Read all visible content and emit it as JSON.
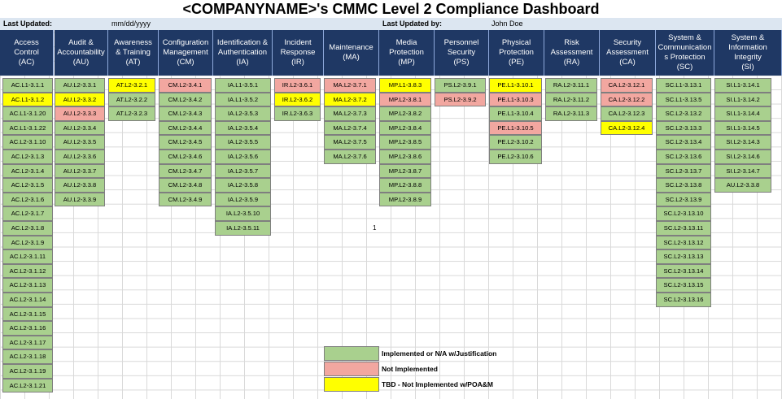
{
  "title": "<COMPANYNAME>'s CMMC Level 2  Compliance Dashboard",
  "info": {
    "last_updated_label": "Last Updated:",
    "last_updated_value": "mm/dd/yyyy",
    "updated_by_label": "Last Updated by:",
    "updated_by_value": "John Doe"
  },
  "colors": {
    "header": "#1f3864",
    "implemented": "#a9d08e",
    "not_implemented": "#f2a7a0",
    "tbd": "#ffff00"
  },
  "columns": [
    {
      "header": "Access\nControl\n(AC)",
      "cells": [
        [
          "AC.L1-3.1.1",
          "g"
        ],
        [
          "AC.L1-3.1.2",
          "y"
        ],
        [
          "AC.L1-3.1.20",
          "g"
        ],
        [
          "AC.L1-3.1.22",
          "g"
        ],
        [
          "AC.L2-3.1.10",
          "g"
        ],
        [
          "AC.L2-3.1.3",
          "g"
        ],
        [
          "AC.L2-3.1.4",
          "g"
        ],
        [
          "AC.L2-3.1.5",
          "g"
        ],
        [
          "AC.L2-3.1.6",
          "g"
        ],
        [
          "AC.L2-3.1.7",
          "g"
        ],
        [
          "AC.L2-3.1.8",
          "g"
        ],
        [
          "AC.L2-3.1.9",
          "g"
        ],
        [
          "AC.L2-3.1.11",
          "g"
        ],
        [
          "AC.L2-3.1.12",
          "g"
        ],
        [
          "AC.L2-3.1.13",
          "g"
        ],
        [
          "AC.L2-3.1.14",
          "g"
        ],
        [
          "AC.L2-3.1.15",
          "g"
        ],
        [
          "AC.L2-3.1.16",
          "g"
        ],
        [
          "AC.L2-3.1.17",
          "g"
        ],
        [
          "AC.L2-3.1.18",
          "g"
        ],
        [
          "AC.L2-3.1.19",
          "g"
        ],
        [
          "AC.L2-3.1.21",
          "g"
        ]
      ]
    },
    {
      "header": "Audit &\nAccountability\n(AU)",
      "cells": [
        [
          "AU.L2-3.3.1",
          "g"
        ],
        [
          "AU.L2-3.3.2",
          "y"
        ],
        [
          "AU.L2-3.3.3",
          "r"
        ],
        [
          "AU.L2-3.3.4",
          "g"
        ],
        [
          "AU.L2-3.3.5",
          "g"
        ],
        [
          "AU.L2-3.3.6",
          "g"
        ],
        [
          "AU.L2-3.3.7",
          "g"
        ],
        [
          "AU.L2-3.3.8",
          "g"
        ],
        [
          "AU.L2-3.3.9",
          "g"
        ]
      ]
    },
    {
      "header": "Awareness\n& Training\n(AT)",
      "cells": [
        [
          "AT.L2-3.2.1",
          "y"
        ],
        [
          "AT.L2-3.2.2",
          "g"
        ],
        [
          "AT.L2-3.2.3",
          "g"
        ]
      ]
    },
    {
      "header": "Configuration\nManagement\n(CM)",
      "cells": [
        [
          "CM.L2-3.4.1",
          "r"
        ],
        [
          "CM.L2-3.4.2",
          "g"
        ],
        [
          "CM.L2-3.4.3",
          "g"
        ],
        [
          "CM.L2-3.4.4",
          "g"
        ],
        [
          "CM.L2-3.4.5",
          "g"
        ],
        [
          "CM.L2-3.4.6",
          "g"
        ],
        [
          "CM.L2-3.4.7",
          "g"
        ],
        [
          "CM.L2-3.4.8",
          "g"
        ],
        [
          "CM.L2-3.4.9",
          "g"
        ]
      ]
    },
    {
      "header": "Identification &\nAuthentication\n(IA)",
      "cells": [
        [
          "IA.L1-3.5.1",
          "g"
        ],
        [
          "IA.L1-3.5.2",
          "g"
        ],
        [
          "IA.L2-3.5.3",
          "g"
        ],
        [
          "IA.L2-3.5.4",
          "g"
        ],
        [
          "IA.L2-3.5.5",
          "g"
        ],
        [
          "IA.L2-3.5.6",
          "g"
        ],
        [
          "IA.L2-3.5.7",
          "g"
        ],
        [
          "IA.L2-3.5.8",
          "g"
        ],
        [
          "IA.L2-3.5.9",
          "g"
        ],
        [
          "IA.L2-3.5.10",
          "g"
        ],
        [
          "IA.L2-3.5.11",
          "g"
        ]
      ]
    },
    {
      "header": "Incident\nResponse\n(IR)",
      "cells": [
        [
          "IR.L2-3.6.1",
          "r"
        ],
        [
          "IR.L2-3.6.2",
          "y"
        ],
        [
          "IR.L2-3.6.3",
          "g"
        ]
      ]
    },
    {
      "header": "Maintenance\n(MA)",
      "cells": [
        [
          "MA.L2-3.7.1",
          "r"
        ],
        [
          "MA.L2-3.7.2",
          "y"
        ],
        [
          "MA.L2-3.7.3",
          "g"
        ],
        [
          "MA.L2-3.7.4",
          "g"
        ],
        [
          "MA.L2-3.7.5",
          "g"
        ],
        [
          "MA.L2-3.7.6",
          "g"
        ]
      ]
    },
    {
      "header": "Media\nProtection\n(MP)",
      "cells": [
        [
          "MP.L1-3.8.3",
          "y"
        ],
        [
          "MP.L2-3.8.1",
          "r"
        ],
        [
          "MP.L2-3.8.2",
          "g"
        ],
        [
          "MP.L2-3.8.4",
          "g"
        ],
        [
          "MP.L2-3.8.5",
          "g"
        ],
        [
          "MP.L2-3.8.6",
          "g"
        ],
        [
          "MP.L2-3.8.7",
          "g"
        ],
        [
          "MP.L2-3.8.8",
          "g"
        ],
        [
          "MP.L2-3.8.9",
          "g"
        ]
      ]
    },
    {
      "header": "Personnel\nSecurity\n(PS)",
      "cells": [
        [
          "PS.L2-3.9.1",
          "g"
        ],
        [
          "PS.L2-3.9.2",
          "r"
        ]
      ]
    },
    {
      "header": "Physical\nProtection\n(PE)",
      "cells": [
        [
          "PE.L1-3.10.1",
          "y"
        ],
        [
          "PE.L1-3.10.3",
          "r"
        ],
        [
          "PE.L1-3.10.4",
          "g"
        ],
        [
          "PE.L1-3.10.5",
          "r"
        ],
        [
          "PE.L2-3.10.2",
          "g"
        ],
        [
          "PE.L2-3.10.6",
          "g"
        ]
      ]
    },
    {
      "header": "Risk\nAssessment\n(RA)",
      "cells": [
        [
          "RA.L2-3.11.1",
          "g"
        ],
        [
          "RA.L2-3.11.2",
          "g"
        ],
        [
          "RA.L2-3.11.3",
          "g"
        ]
      ]
    },
    {
      "header": "Security\nAssessment\n(CA)",
      "cells": [
        [
          "CA.L2-3.12.1",
          "r"
        ],
        [
          "CA.L2-3.12.2",
          "r"
        ],
        [
          "CA.L2-3.12.3",
          "g"
        ],
        [
          "CA.L2-3.12.4",
          "y"
        ]
      ]
    },
    {
      "header": "System &\nCommunication\ns Protection\n(SC)",
      "cells": [
        [
          "SC.L1-3.13.1",
          "g"
        ],
        [
          "SC.L1-3.13.5",
          "g"
        ],
        [
          "SC.L2-3.13.2",
          "g"
        ],
        [
          "SC.L2-3.13.3",
          "g"
        ],
        [
          "SC.L2-3.13.4",
          "g"
        ],
        [
          "SC.L2-3.13.6",
          "g"
        ],
        [
          "SC.L2-3.13.7",
          "g"
        ],
        [
          "SC.L2-3.13.8",
          "g"
        ],
        [
          "SC.L2-3.13.9",
          "g"
        ],
        [
          "SC.L2-3.13.10",
          "g"
        ],
        [
          "SC.L2-3.13.11",
          "g"
        ],
        [
          "SC.L2-3.13.12",
          "g"
        ],
        [
          "SC.L2-3.13.13",
          "g"
        ],
        [
          "SC.L2-3.13.14",
          "g"
        ],
        [
          "SC.L2-3.13.15",
          "g"
        ],
        [
          "SC.L2-3.13.16",
          "g"
        ]
      ]
    },
    {
      "header": "System &\nInformation\nIntegrity\n(SI)",
      "cells": [
        [
          "SI.L1-3.14.1",
          "g"
        ],
        [
          "SI.L1-3.14.2",
          "g"
        ],
        [
          "SI.L1-3.14.4",
          "g"
        ],
        [
          "SI.L1-3.14.5",
          "g"
        ],
        [
          "SI.L2-3.14.3",
          "g"
        ],
        [
          "SI.L2-3.14.6",
          "g"
        ],
        [
          "SI.L2-3.14.7",
          "g"
        ],
        [
          "AU.L2-3.3.8",
          "g"
        ]
      ]
    }
  ],
  "stray_value": "1",
  "legend": [
    {
      "label": "Implemented or N/A w/Justification",
      "status": "g"
    },
    {
      "label": "Not Implemented",
      "status": "r"
    },
    {
      "label": "TBD - Not Implemented w/POA&M",
      "status": "y"
    }
  ]
}
